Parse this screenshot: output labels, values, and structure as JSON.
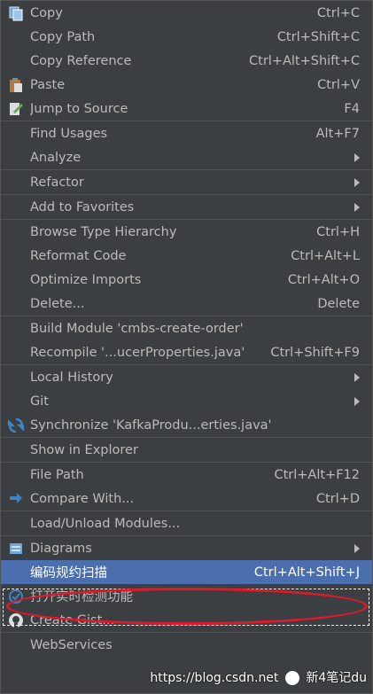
{
  "groups": [
    [
      {
        "label": "Copy",
        "shortcut": "Ctrl+C",
        "icon": "copy-icon"
      },
      {
        "label": "Copy Path",
        "shortcut": "Ctrl+Shift+C"
      },
      {
        "label": "Copy Reference",
        "shortcut": "Ctrl+Alt+Shift+C"
      },
      {
        "label": "Paste",
        "shortcut": "Ctrl+V",
        "icon": "paste-icon"
      },
      {
        "label": "Jump to Source",
        "shortcut": "F4",
        "icon": "jump-to-source-icon"
      }
    ],
    [
      {
        "label": "Find Usages",
        "shortcut": "Alt+F7"
      },
      {
        "label": "Analyze",
        "submenu": true
      }
    ],
    [
      {
        "label": "Refactor",
        "submenu": true
      }
    ],
    [
      {
        "label": "Add to Favorites",
        "submenu": true
      }
    ],
    [
      {
        "label": "Browse Type Hierarchy",
        "shortcut": "Ctrl+H"
      },
      {
        "label": "Reformat Code",
        "shortcut": "Ctrl+Alt+L"
      },
      {
        "label": "Optimize Imports",
        "shortcut": "Ctrl+Alt+O"
      },
      {
        "label": "Delete...",
        "shortcut": "Delete"
      }
    ],
    [
      {
        "label": "Build Module 'cmbs-create-order'"
      },
      {
        "label": "Recompile '...ucerProperties.java'",
        "shortcut": "Ctrl+Shift+F9"
      }
    ],
    [
      {
        "label": "Local History",
        "submenu": true
      },
      {
        "label": "Git",
        "submenu": true
      },
      {
        "label": "Synchronize 'KafkaProdu...erties.java'",
        "icon": "synchronize-icon"
      }
    ],
    [
      {
        "label": "Show in Explorer"
      }
    ],
    [
      {
        "label": "File Path",
        "shortcut": "Ctrl+Alt+F12"
      },
      {
        "label": "Compare With...",
        "shortcut": "Ctrl+D",
        "icon": "compare-icon"
      }
    ],
    [
      {
        "label": "Load/Unload Modules..."
      }
    ],
    [
      {
        "label": "Diagrams",
        "submenu": true,
        "icon": "diagram-icon"
      },
      {
        "label": "编码规约扫描",
        "shortcut": "Ctrl+Alt+Shift+J",
        "highlighted": true
      },
      {
        "label": "打开实时检测功能",
        "icon": "realtime-check-icon"
      },
      {
        "label": "Create Gist...",
        "icon": "github-icon"
      }
    ],
    [
      {
        "label": "WebServices"
      }
    ]
  ],
  "watermark": {
    "url": "https://blog.csdn.net",
    "brand": "新4笔记du"
  }
}
